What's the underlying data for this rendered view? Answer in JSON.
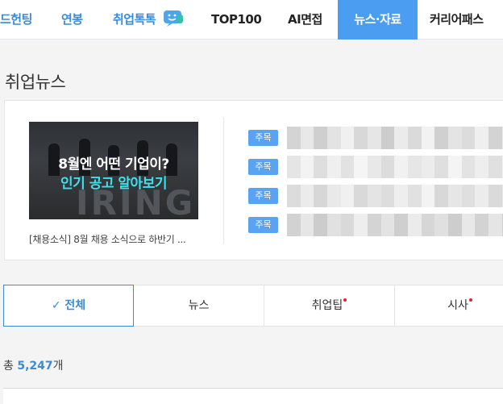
{
  "nav": {
    "items": [
      {
        "label": "드헌팅",
        "style": "blue"
      },
      {
        "label": "연봉",
        "style": "blue"
      },
      {
        "label": "취업톡톡",
        "style": "blue"
      },
      {
        "label": "TOP100",
        "style": "dark"
      },
      {
        "label": "AI면접",
        "style": "dark"
      },
      {
        "label": "뉴스·자료",
        "style": "active"
      },
      {
        "label": "커리어패스",
        "style": "dark"
      }
    ]
  },
  "section": {
    "title": "취업뉴스"
  },
  "featured": {
    "thumbnail": {
      "line1": "8월엔 어떤 기업이?",
      "line2": "인기 공고 알아보기",
      "background_text": "IRING"
    },
    "caption": "[채용소식] 8월 채용 소식으로 하반기 ..."
  },
  "headlines": [
    {
      "badge": "주목"
    },
    {
      "badge": "주목"
    },
    {
      "badge": "주목"
    },
    {
      "badge": "주목"
    }
  ],
  "tabs": [
    {
      "label": "전체",
      "check": "✓",
      "active": true,
      "dot": false
    },
    {
      "label": "뉴스",
      "active": false,
      "dot": false
    },
    {
      "label": "취업팁",
      "active": false,
      "dot": true
    },
    {
      "label": "시사",
      "active": false,
      "dot": true
    }
  ],
  "total": {
    "prefix": "총",
    "count": "5,247",
    "suffix": "개"
  },
  "colors": {
    "accent": "#3a8bd8",
    "active_nav": "#4a9df0",
    "badge": "#5aa3f0",
    "new_dot": "#e5232b",
    "thumb_highlight": "#3fe0ee"
  },
  "icons": {
    "talk": "chat-bubble-smile-icon",
    "tab_check": "check-icon"
  }
}
